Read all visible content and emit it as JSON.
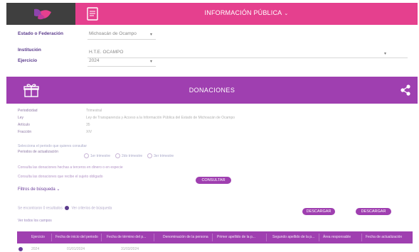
{
  "header": {
    "title": "INFORMACIÓN PÚBLICA",
    "title_caret": "⌄",
    "brand_color": "#e5408e",
    "logo_bg": "#3f3f3f"
  },
  "filters": {
    "entity_label": "Estado o Federación",
    "entity_value": "Michoacán de Ocampo",
    "institution_label": "Institución",
    "institution_value": "H.T.E. OCAMPO",
    "year_label": "Ejercicio",
    "year_value": "2024"
  },
  "section": {
    "title": "DONACIONES",
    "color": "#9f3fb0",
    "icons": {
      "left": "gift-box-icon",
      "share": "share-icon"
    }
  },
  "meta": {
    "rows": [
      {
        "label": "Periodicidad",
        "value": "Trimestral"
      },
      {
        "label": "Ley",
        "value": "Ley de Transparencia y Acceso a la Información Pública del Estado de Michoacán de Ocampo"
      },
      {
        "label": "Artículo",
        "value": "35"
      },
      {
        "label": "Fracción",
        "value": "XIV"
      }
    ]
  },
  "period": {
    "question": "Selecciona el periodo que quieres consultar",
    "label": "Periodos de actualización",
    "options": [
      "1er trimestre",
      "2do trimestre",
      "3er trimestre"
    ]
  },
  "notes": {
    "line1": "Consulta las donaciones hechas a terceros en dinero o en especie",
    "line2": "Consulta las donaciones que recibe el sujeto obligado"
  },
  "buttons": {
    "consult": "CONSULTAR",
    "download": "DESCARGAR",
    "download_alt": "DESCARGAR"
  },
  "filter_link": "Filtros de búsqueda ⌄",
  "info": {
    "text_before": "Se encontraron 0 resultados",
    "text_after": "Ver criterios de búsqueda"
  },
  "sub_link": "Ver todos los campos",
  "table": {
    "headers": [
      "Ejercicio",
      "Fecha de inicio del periodo",
      "Fecha de término del p...",
      "Denominación de la persona",
      "Primer apellido de la p...",
      "Segundo apellido de la p...",
      "Área responsable",
      "Fecha de actualización"
    ],
    "first_row": [
      "2024",
      "01/01/2024",
      "31/03/2024"
    ]
  }
}
